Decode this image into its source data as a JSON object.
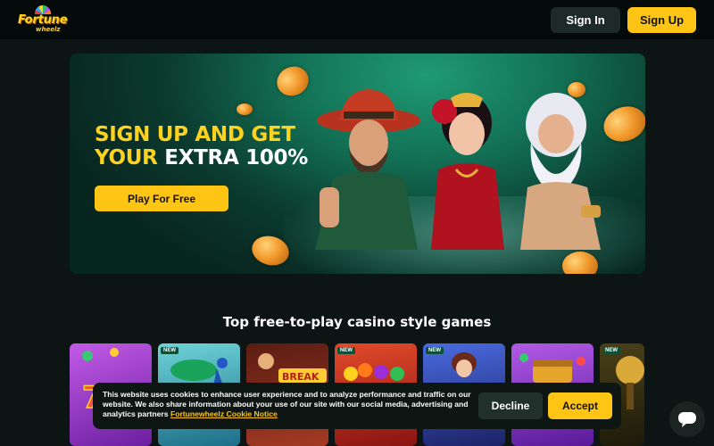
{
  "header": {
    "logo_text": "Fortune",
    "logo_sub": "wheelz",
    "sign_in_label": "Sign In",
    "sign_up_label": "Sign Up"
  },
  "hero": {
    "title_line1": "SIGN UP AND GET",
    "title_line2_yellow": "YOUR",
    "title_line2_white": "EXTRA 100%",
    "play_label": "Play For Free"
  },
  "games": {
    "section_title": "Top free-to-play casino style games",
    "badge_new": "NEW",
    "tiles": [
      {
        "name": "777",
        "new": false,
        "color": "#b04ad6"
      },
      {
        "name": "peacock",
        "new": true,
        "color": "#2a8fa0"
      },
      {
        "name": "BREAK",
        "new": false,
        "color": "#7a2a22"
      },
      {
        "name": "fruits",
        "new": true,
        "color": "#c0392b"
      },
      {
        "name": "lady",
        "new": true,
        "color": "#2f3c8f"
      },
      {
        "name": "treasure",
        "new": false,
        "color": "#9b3fd1"
      },
      {
        "name": "tree",
        "new": true,
        "color": "#3d3512"
      }
    ]
  },
  "cookie": {
    "text": "This website uses cookies to enhance user experience and to analyze performance and traffic on our website. We also share information about your use of our site with our social media, advertising and analytics partners",
    "link_text": "Fortunewheelz Cookie Notice",
    "decline_label": "Decline",
    "accept_label": "Accept"
  },
  "colors": {
    "accent": "#ffc514",
    "background": "#0c1513"
  },
  "icons": {
    "chat": "chat-bubble-icon"
  }
}
